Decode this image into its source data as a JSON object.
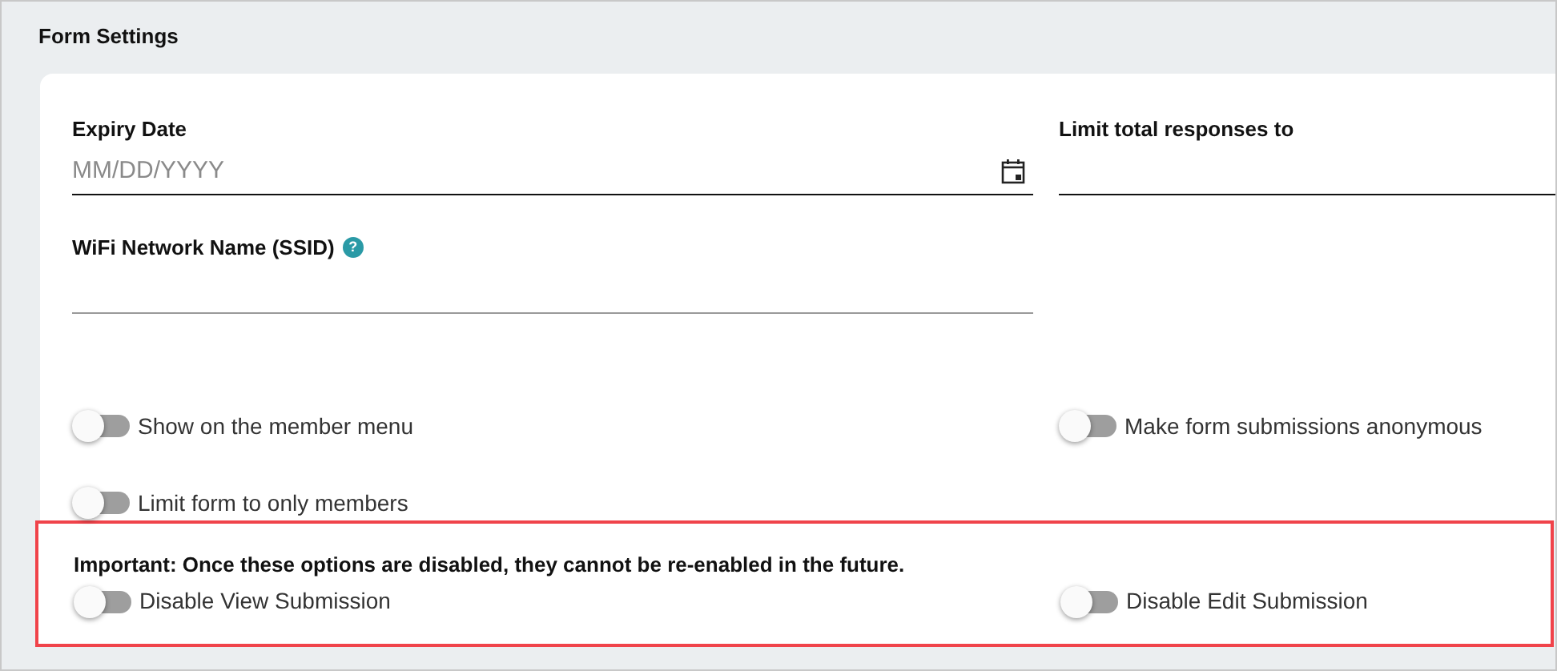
{
  "title": "Form Settings",
  "fields": [
    {
      "label": "Expiry Date",
      "kind": "date",
      "placeholder": "MM/DD/YYYY"
    },
    {
      "label": "Limit total responses to",
      "kind": "number"
    },
    {
      "label": "WiFi Network Name (SSID)",
      "kind": "text",
      "help_icon": "?"
    }
  ],
  "toggles": [
    {
      "label": "Show on the member menu",
      "on": false
    },
    {
      "label": "Make form submissions anonymous",
      "on": false
    },
    {
      "label": "Limit form to only members",
      "on": false
    }
  ],
  "notice": {
    "text": "Important: Once these options are disabled, they cannot be re-enabled in the future.",
    "toggles": [
      {
        "label": "Disable View Submission",
        "on": false
      },
      {
        "label": "Disable Edit Submission",
        "on": false
      }
    ]
  }
}
